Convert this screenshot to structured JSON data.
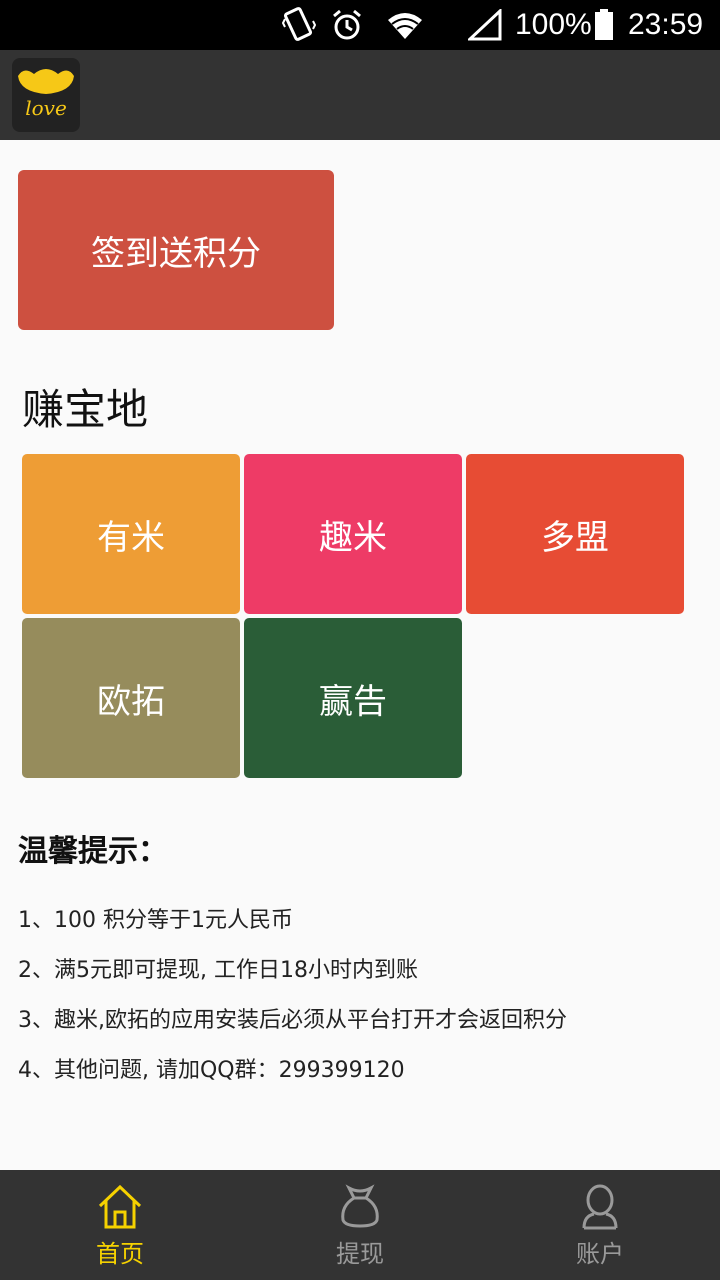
{
  "status_bar": {
    "battery": "100%",
    "time": "23:59",
    "icons": [
      "vibrate-icon",
      "alarm-icon",
      "wifi-icon",
      "signal-icon",
      "battery-icon"
    ]
  },
  "app_bar": {
    "logo_text": "love",
    "logo_color": "#f6c817"
  },
  "signin_button": {
    "label": "签到送积分",
    "color": "#cd5040"
  },
  "earn_section": {
    "title": "赚宝地",
    "tiles": [
      {
        "label": "有米",
        "color": "#ee9d35"
      },
      {
        "label": "趣米",
        "color": "#ee3b66"
      },
      {
        "label": "多盟",
        "color": "#e74c34"
      },
      {
        "label": "欧拓",
        "color": "#968c5c"
      },
      {
        "label": "赢告",
        "color": "#2a5d37"
      }
    ]
  },
  "tips": {
    "title": "温馨提示：",
    "items": [
      "1、100 积分等于1元人民币",
      "2、满5元即可提现, 工作日18小时内到账",
      "3、趣米,欧拓的应用安装后必须从平台打开才会返回积分",
      "4、其他问题, 请加QQ群：299399120"
    ]
  },
  "bottom_nav": {
    "items": [
      {
        "label": "首页",
        "icon": "home-icon",
        "active": true
      },
      {
        "label": "提现",
        "icon": "money-bag-icon",
        "active": false
      },
      {
        "label": "账户",
        "icon": "user-icon",
        "active": false
      }
    ],
    "active_color": "#f6d200",
    "inactive_color": "#9a9a9a"
  }
}
